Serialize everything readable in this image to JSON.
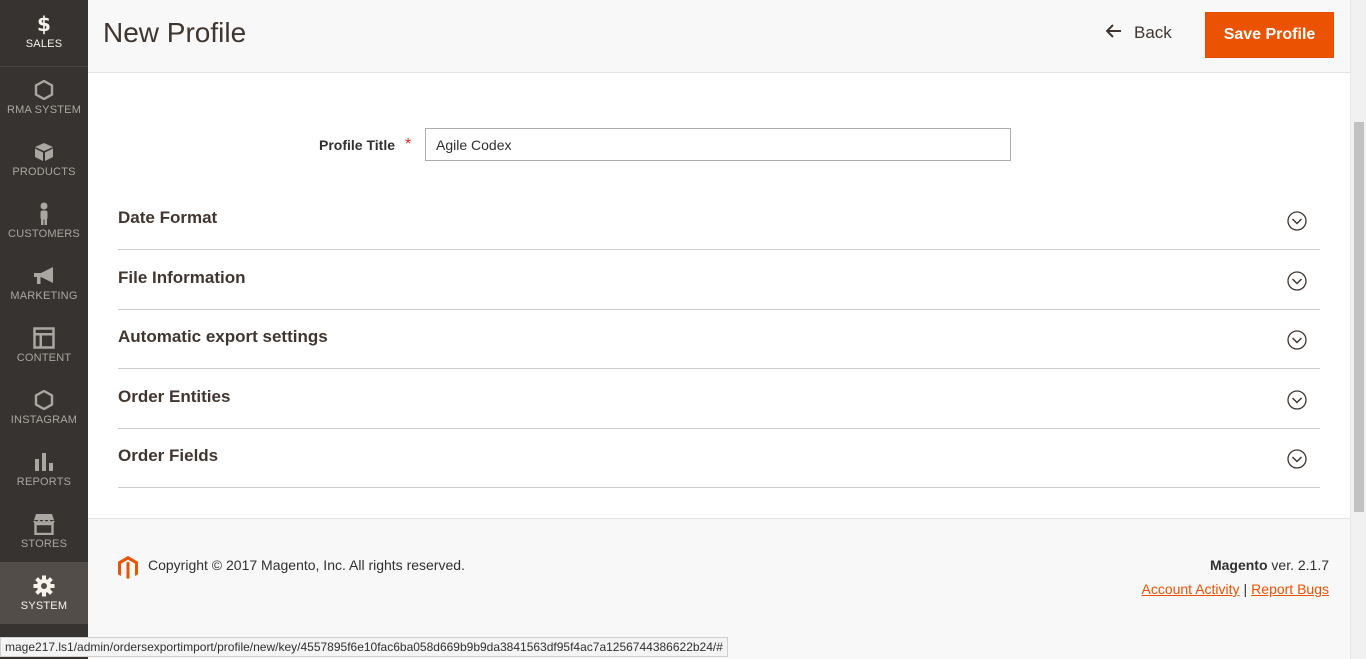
{
  "sidebar": {
    "items": [
      {
        "label": "SALES",
        "icon": "dollar-icon",
        "active": false
      },
      {
        "label": "RMA SYSTEM",
        "icon": "hexagon-icon",
        "active": false
      },
      {
        "label": "PRODUCTS",
        "icon": "cube-icon",
        "active": false
      },
      {
        "label": "CUSTOMERS",
        "icon": "person-icon",
        "active": false
      },
      {
        "label": "MARKETING",
        "icon": "megaphone-icon",
        "active": false
      },
      {
        "label": "CONTENT",
        "icon": "layout-icon",
        "active": false
      },
      {
        "label": "INSTAGRAM",
        "icon": "hexagon-icon",
        "active": false
      },
      {
        "label": "REPORTS",
        "icon": "bar-chart-icon",
        "active": false
      },
      {
        "label": "STORES",
        "icon": "storefront-icon",
        "active": false
      },
      {
        "label": "SYSTEM",
        "icon": "gear-icon",
        "active": true
      }
    ]
  },
  "header": {
    "title": "New Profile",
    "back_label": "Back",
    "save_label": "Save Profile"
  },
  "form": {
    "profile_title_label": "Profile Title",
    "required_mark": "*",
    "profile_title_value": "Agile Codex"
  },
  "sections": [
    {
      "title": "Date Format"
    },
    {
      "title": "File Information"
    },
    {
      "title": "Automatic export settings"
    },
    {
      "title": "Order Entities"
    },
    {
      "title": "Order Fields"
    }
  ],
  "footer": {
    "copyright": "Copyright © 2017 Magento, Inc. All rights reserved.",
    "brand": "Magento",
    "version": " ver. 2.1.7",
    "account_activity": "Account Activity",
    "separator": "|",
    "report_bugs": "Report Bugs"
  },
  "status_url": "mage217.ls1/admin/ordersexportimport/profile/new/key/4557895f6e10fac6ba058d669b9b9da3841563df95f4ac7a1256744386622b24/#",
  "colors": {
    "accent": "#eb5202",
    "sidebar_bg": "#373330",
    "sidebar_active": "#524d49"
  }
}
